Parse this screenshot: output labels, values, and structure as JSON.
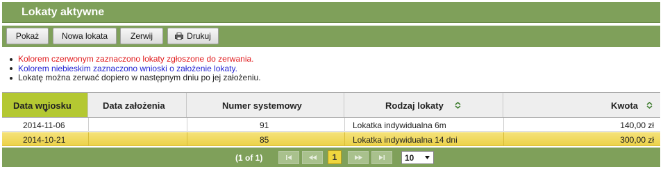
{
  "header": {
    "title": "Lokaty aktywne"
  },
  "toolbar": {
    "show_label": "Pokaż",
    "new_label": "Nowa lokata",
    "break_label": "Zerwij",
    "print_label": "Drukuj"
  },
  "notes": [
    {
      "text": "Kolorem czerwonym zaznaczono lokaty zgłoszone do zerwania.",
      "color": "#e0191b"
    },
    {
      "text": "Kolorem niebieskim zaznaczono wnioski o założenie lokaty.",
      "color": "#1f1fd0"
    },
    {
      "text": "Lokatę można zerwać dopiero w następnym dniu po jej założeniu.",
      "color": "#222222"
    }
  ],
  "table": {
    "columns": [
      {
        "label": "Data wniosku",
        "sort": "desc-active"
      },
      {
        "label": "Data założenia",
        "sort": "none"
      },
      {
        "label": "Numer systemowy",
        "sort": "none"
      },
      {
        "label": "Rodzaj lokaty",
        "sort": "sortable"
      },
      {
        "label": "Kwota",
        "sort": "sortable"
      }
    ],
    "rows": [
      {
        "date_request": "2014-11-06",
        "date_created": "",
        "system_number": "91",
        "type": "Lokatka indywidualna 6m",
        "amount": "140,00 zł",
        "highlighted": false
      },
      {
        "date_request": "2014-10-21",
        "date_created": "",
        "system_number": "85",
        "type": "Lokatka indywidualna 14 dni",
        "amount": "300,00 zł",
        "highlighted": true
      }
    ]
  },
  "pager": {
    "info": "(1 of 1)",
    "current_page": "1",
    "page_size": "10",
    "icons": [
      "first-page-icon",
      "prev-page-icon",
      "next-page-icon",
      "last-page-icon"
    ]
  },
  "colors": {
    "bar_green": "#7fa05a",
    "active_column": "#b4c832",
    "highlight_row": "#f0d63e"
  }
}
